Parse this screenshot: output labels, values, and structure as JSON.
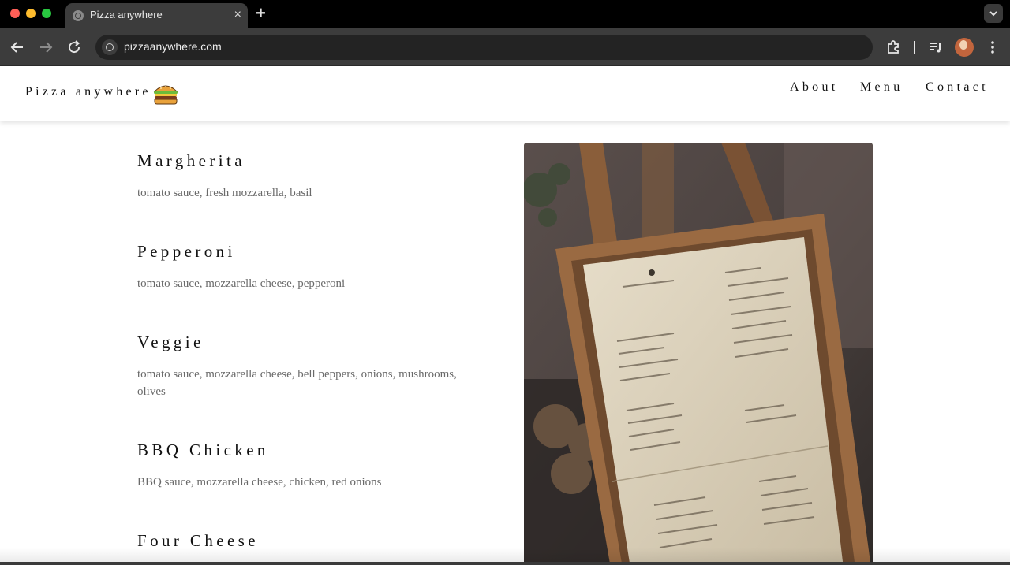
{
  "browser": {
    "tab_title": "Pizza anywhere",
    "tab_close": "×",
    "new_tab": "+",
    "url": "pizzaanywhere.com"
  },
  "site": {
    "brand": "Pizza anywhere",
    "logo_icon": "burger-icon",
    "nav": {
      "about": "About",
      "menu": "Menu",
      "contact": "Contact"
    }
  },
  "menu_items": [
    {
      "name": "Margherita",
      "description": "tomato sauce, fresh mozzarella, basil"
    },
    {
      "name": "Pepperoni",
      "description": "tomato sauce, mozzarella cheese, pepperoni"
    },
    {
      "name": "Veggie",
      "description": "tomato sauce, mozzarella cheese, bell peppers, onions, mushrooms, olives"
    },
    {
      "name": "BBQ Chicken",
      "description": "BBQ sauce, mozzarella cheese, chicken, red onions"
    },
    {
      "name": "Four Cheese",
      "description": ""
    }
  ],
  "colors": {
    "page_bg": "#ffffff",
    "text": "#111111",
    "muted_text": "#6a6a6a"
  }
}
